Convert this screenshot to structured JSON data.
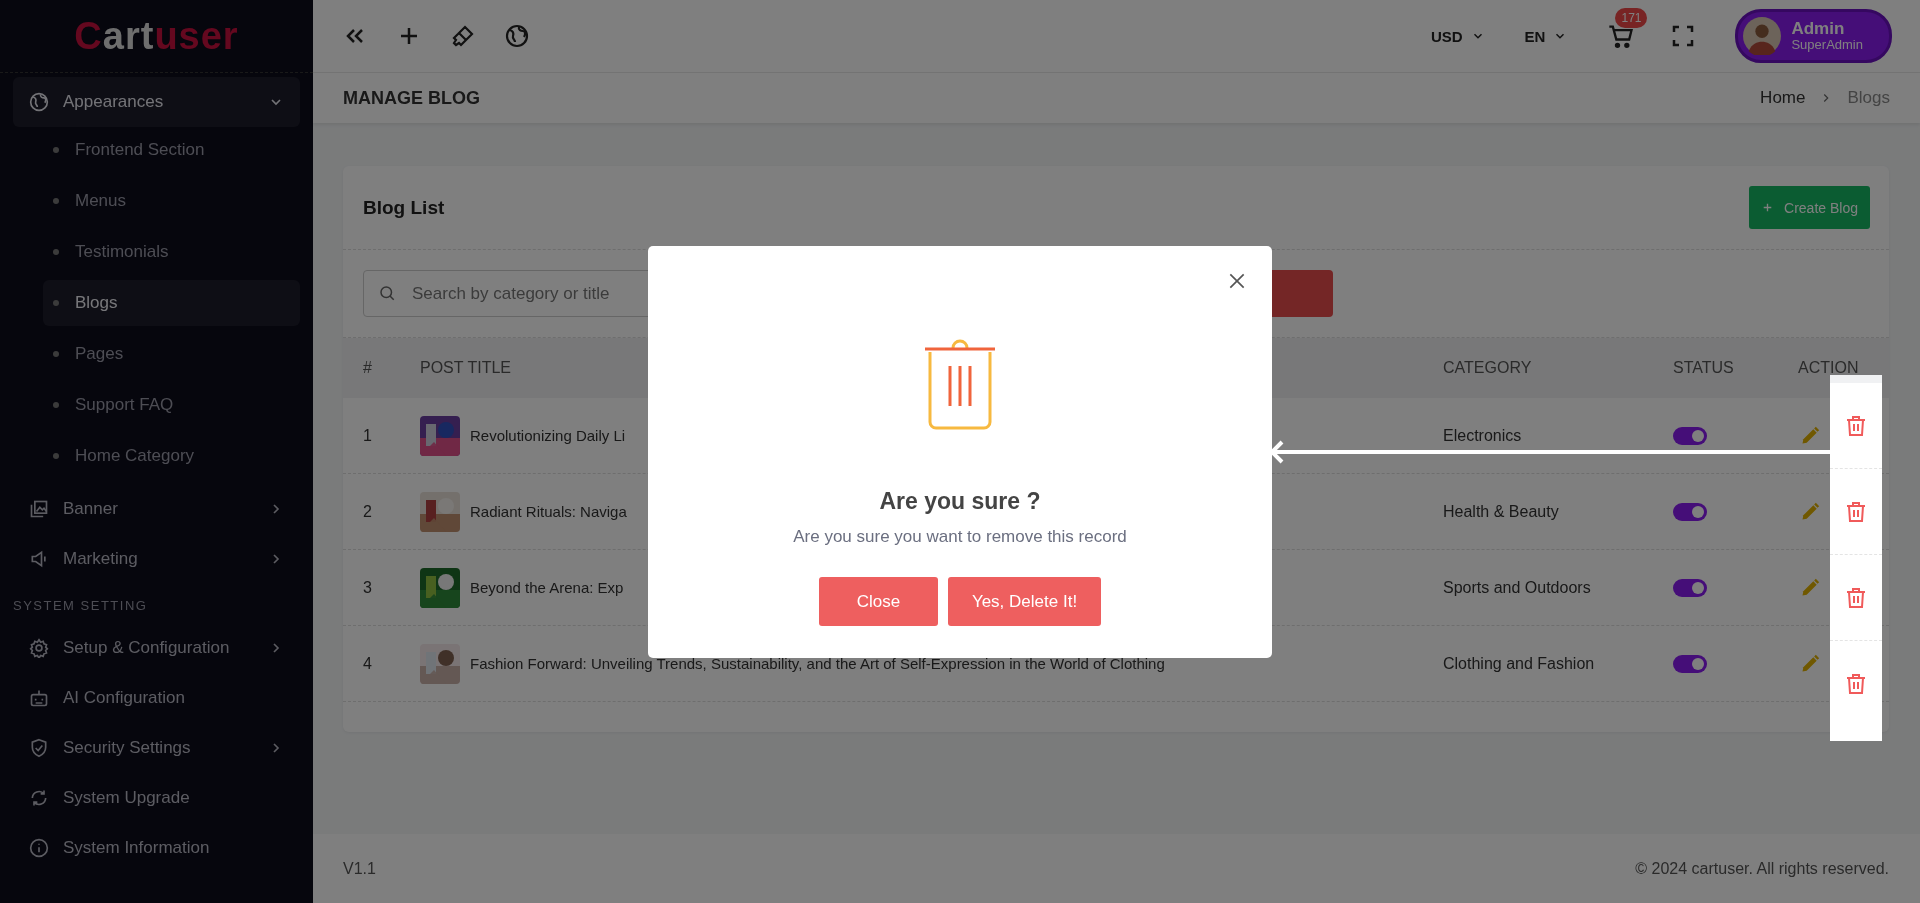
{
  "sidebar": {
    "logo": {
      "lead": "C",
      "light": "art",
      "accent": "user"
    },
    "items": [
      {
        "kind": "menu",
        "label": "Appearances",
        "expanded": true,
        "children": [
          {
            "label": "Frontend Section",
            "selected": false
          },
          {
            "label": "Menus",
            "selected": false
          },
          {
            "label": "Testimonials",
            "selected": false
          },
          {
            "label": "Blogs",
            "selected": true
          },
          {
            "label": "Pages",
            "selected": false
          },
          {
            "label": "Support FAQ",
            "selected": false
          },
          {
            "label": "Home Category",
            "selected": false
          }
        ]
      },
      {
        "kind": "menu",
        "label": "Banner",
        "expanded": false
      },
      {
        "kind": "menu",
        "label": "Marketing",
        "expanded": false
      },
      {
        "kind": "section",
        "label": "SYSTEM SETTING"
      },
      {
        "kind": "menu",
        "label": "Setup & Configuration",
        "expanded": false
      },
      {
        "kind": "link",
        "label": "AI Configuration"
      },
      {
        "kind": "menu",
        "label": "Security Settings",
        "expanded": false
      },
      {
        "kind": "link",
        "label": "System Upgrade"
      },
      {
        "kind": "link",
        "label": "System Information"
      }
    ]
  },
  "topbar": {
    "currency": "USD",
    "language": "EN",
    "cart_count": "171",
    "user": {
      "name": "Admin",
      "role": "SuperAdmin"
    }
  },
  "page": {
    "title": "MANAGE BLOG",
    "breadcrumb": [
      {
        "label": "Home",
        "selected": false
      },
      {
        "label": "Blogs",
        "selected": true
      }
    ]
  },
  "card": {
    "title": "Blog List",
    "create_button": "Create Blog",
    "search": {
      "placeholder": "Search by category or title"
    },
    "table": {
      "columns": [
        "#",
        "POST TITLE",
        "CATEGORY",
        "STATUS",
        "ACTION"
      ],
      "rows": [
        {
          "index": "1",
          "title": "Revolutionizing Daily Li",
          "category": "Electronics",
          "on": true
        },
        {
          "index": "2",
          "title": "Radiant Rituals: Naviga",
          "category": "Health & Beauty",
          "on": true
        },
        {
          "index": "3",
          "title": "Beyond the Arena: Exp",
          "category": "Sports and Outdoors",
          "on": true
        },
        {
          "index": "4",
          "title": "Fashion Forward: Unveiling Trends, Sustainability, and the Art of Self-Expression in the World of Clothing",
          "category": "Clothing and Fashion",
          "on": true
        }
      ]
    }
  },
  "dialog": {
    "title": "Are you sure ?",
    "message": "Are you sure you want to remove this record",
    "buttons": [
      "Close",
      "Yes, Delete It!"
    ]
  },
  "footer": {
    "version": "V1.1",
    "copyright": "© 2024 cartuser. All rights reserved."
  }
}
